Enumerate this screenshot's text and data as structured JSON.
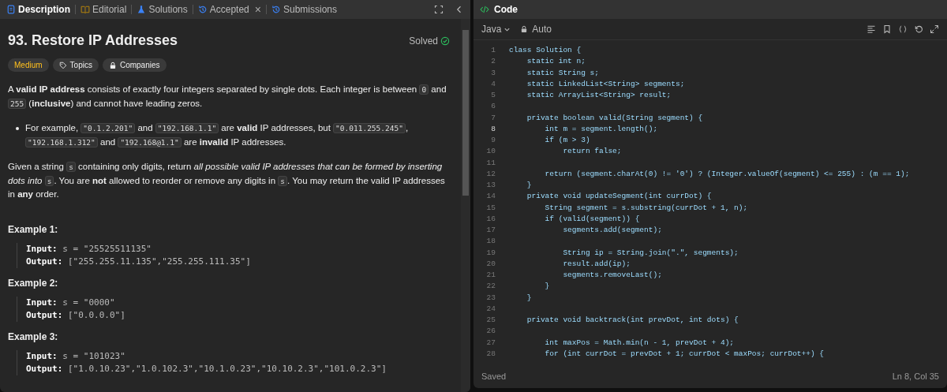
{
  "description_panel": {
    "tabs": [
      {
        "label": "Description",
        "kind": "description",
        "selected": true
      },
      {
        "label": "Editorial",
        "kind": "editorial",
        "selected": false
      },
      {
        "label": "Solutions",
        "kind": "solutions",
        "selected": false
      },
      {
        "label": "Accepted",
        "kind": "accepted",
        "selected": false,
        "close": "×"
      },
      {
        "label": "Submissions",
        "kind": "submissions",
        "selected": false
      }
    ],
    "title": "93. Restore IP Addresses",
    "status": "Solved",
    "tags": [
      {
        "label": "Medium",
        "kind": "difficulty"
      },
      {
        "label": "Topics",
        "kind": "topics"
      },
      {
        "label": "Companies",
        "kind": "companies"
      }
    ],
    "paragraphs": [
      {
        "kind": "text",
        "segments": [
          {
            "kind": "text",
            "text": "A **valid IP address** consists of exactly four integers separated by single dots. Each integer is between "
          },
          {
            "kind": "code",
            "text": "0"
          },
          {
            "kind": "text",
            "text": " and "
          },
          {
            "kind": "code",
            "text": "255"
          },
          {
            "kind": "text",
            "text": " (**inclusive**) and cannot have leading zeros."
          }
        ]
      },
      {
        "kind": "bullet",
        "segments": [
          {
            "kind": "text",
            "text": "For example, "
          },
          {
            "kind": "code",
            "text": "\"0.1.2.201\""
          },
          {
            "kind": "text",
            "text": " and "
          },
          {
            "kind": "code",
            "text": "\"192.168.1.1\""
          },
          {
            "kind": "text",
            "text": " are **valid** IP addresses, but "
          },
          {
            "kind": "code",
            "text": "\"0.011.255.245\""
          },
          {
            "kind": "text",
            "text": ", "
          },
          {
            "kind": "code",
            "text": "\"192.168.1.312\""
          },
          {
            "kind": "text",
            "text": " and "
          },
          {
            "kind": "code",
            "text": "\"192.168@1.1\""
          },
          {
            "kind": "text",
            "text": " are **invalid** IP addresses."
          }
        ]
      },
      {
        "kind": "text",
        "segments": [
          {
            "kind": "text",
            "text": "Given a string "
          },
          {
            "kind": "code",
            "text": "s"
          },
          {
            "kind": "text",
            "text": " containing only digits, return *all possible valid IP addresses that can be formed by inserting dots into* "
          },
          {
            "kind": "code",
            "text": "s"
          },
          {
            "kind": "text",
            "text": ". You are **not** allowed to reorder or remove any digits in "
          },
          {
            "kind": "code",
            "text": "s"
          },
          {
            "kind": "text",
            "text": ". You may return the valid IP addresses in **any** order."
          }
        ]
      }
    ],
    "examples": [
      {
        "title": "Example 1:",
        "input_label": "Input:",
        "input": "s = \"25525511135\"",
        "output_label": "Output:",
        "output": "[\"255.255.11.135\",\"255.255.111.35\"]"
      },
      {
        "title": "Example 2:",
        "input_label": "Input:",
        "input": "s = \"0000\"",
        "output_label": "Output:",
        "output": "[\"0.0.0.0\"]"
      },
      {
        "title": "Example 3:",
        "input_label": "Input:",
        "input": "s = \"101023\"",
        "output_label": "Output:",
        "output": "[\"1.0.10.23\",\"1.0.102.3\",\"10.1.0.23\",\"10.10.2.3\",\"101.0.2.3\"]"
      }
    ]
  },
  "code_panel": {
    "title": "Code",
    "language": "Java",
    "mode": "Auto",
    "lines": [
      {
        "number": "1",
        "text": "class Solution {",
        "active": false
      },
      {
        "number": "2",
        "text": "    static int n;",
        "active": false
      },
      {
        "number": "3",
        "text": "    static String s;",
        "active": false
      },
      {
        "number": "4",
        "text": "    static LinkedList<String> segments;",
        "active": false
      },
      {
        "number": "5",
        "text": "    static ArrayList<String> result;",
        "active": false
      },
      {
        "number": "6",
        "active": false
      },
      {
        "number": "7",
        "text": "    private boolean valid(String segment) {",
        "active": false
      },
      {
        "number": "8",
        "text": "        int m = segment.length();",
        "active": true
      },
      {
        "number": "9",
        "text": "        if (m > 3)",
        "active": false
      },
      {
        "number": "10",
        "text": "            return false;",
        "active": false
      },
      {
        "number": "11",
        "active": false
      },
      {
        "number": "12",
        "text": "        return (segment.charAt(0) != '0') ? (Integer.valueOf(segment) <= 255) : (m == 1);",
        "active": false
      },
      {
        "number": "13",
        "text": "    }",
        "active": false
      },
      {
        "number": "14",
        "text": "    private void updateSegment(int currDot) {",
        "active": false
      },
      {
        "number": "15",
        "text": "        String segment = s.substring(currDot + 1, n);",
        "active": false
      },
      {
        "number": "16",
        "text": "        if (valid(segment)) {",
        "active": false
      },
      {
        "number": "17",
        "text": "            segments.add(segment);",
        "active": false
      },
      {
        "number": "18",
        "active": false
      },
      {
        "number": "19",
        "text": "            String ip = String.join(\".\", segments);",
        "active": false
      },
      {
        "number": "20",
        "text": "            result.add(ip);",
        "active": false
      },
      {
        "number": "21",
        "text": "            segments.removeLast();",
        "active": false
      },
      {
        "number": "22",
        "text": "        }",
        "active": false
      },
      {
        "number": "23",
        "text": "    }",
        "active": false
      },
      {
        "number": "24",
        "active": false
      },
      {
        "number": "25",
        "text": "    private void backtrack(int prevDot, int dots) {",
        "active": false
      },
      {
        "number": "26",
        "active": false
      },
      {
        "number": "27",
        "text": "        int maxPos = Math.min(n - 1, prevDot + 4);",
        "active": false
      },
      {
        "number": "28",
        "text": "        for (int currDot = prevDot + 1; currDot < maxPos; currDot++) {",
        "active": false
      }
    ],
    "save_status": "Saved",
    "cursor_position": "Ln 8, Col 35"
  }
}
